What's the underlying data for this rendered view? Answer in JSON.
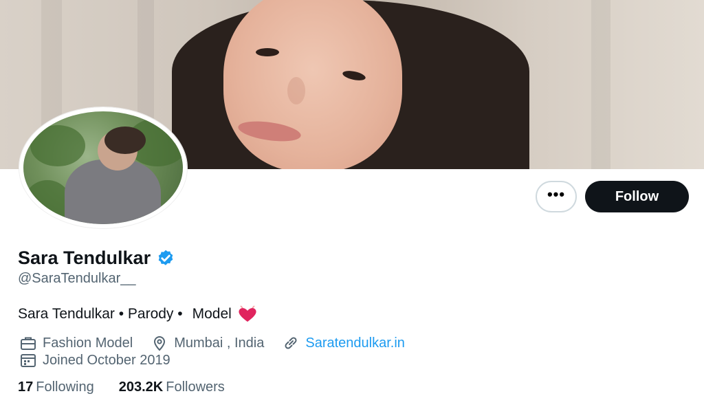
{
  "profile": {
    "display_name": "Sara Tendulkar",
    "handle": "@SaraTendulkar__",
    "verified": true,
    "bio": {
      "part1": "Sara Tendulkar • Parody •",
      "part2": "Model",
      "emoji": "heart-emoji"
    },
    "category": "Fashion Model",
    "location": "Mumbai , India",
    "website": "Saratendulkar.in",
    "joined": "Joined October 2019",
    "following_count": "17",
    "following_label": "Following",
    "followers_count": "203.2K",
    "followers_label": "Followers"
  },
  "actions": {
    "more_label": "•••",
    "follow_label": "Follow"
  },
  "icons": {
    "category": "briefcase-icon",
    "location": "location-pin-icon",
    "website": "link-icon",
    "joined": "calendar-icon",
    "verified": "verified-badge-icon"
  },
  "colors": {
    "accent": "#1d9bf0",
    "text_primary": "#0f1419",
    "text_secondary": "#536471",
    "follow_button": "#0f1419",
    "heart": "#e0245e"
  }
}
